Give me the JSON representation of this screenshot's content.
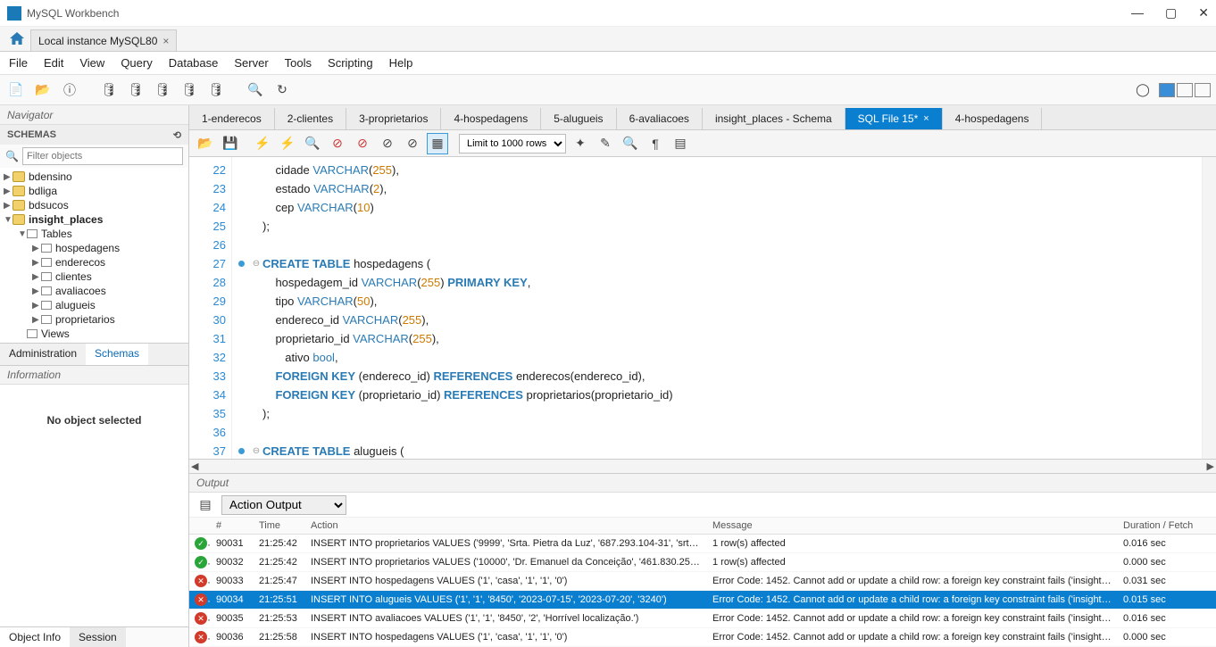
{
  "app_title": "MySQL Workbench",
  "connection_tab": "Local instance MySQL80",
  "menubar": [
    "File",
    "Edit",
    "View",
    "Query",
    "Database",
    "Server",
    "Tools",
    "Scripting",
    "Help"
  ],
  "navigator": {
    "title": "Navigator",
    "section": "SCHEMAS",
    "filter_placeholder": "Filter objects",
    "tree": {
      "schemas": [
        "bdensino",
        "bdliga",
        "bdsucos"
      ],
      "active_schema": "insight_places",
      "tables_label": "Tables",
      "tables": [
        "hospedagens",
        "enderecos",
        "clientes",
        "avaliacoes",
        "alugueis",
        "proprietarios"
      ],
      "views_label": "Views"
    },
    "nav_tabs": [
      "Administration",
      "Schemas"
    ],
    "info_title": "Information",
    "info_body": "No object selected",
    "bottom_tabs": [
      "Object Info",
      "Session"
    ]
  },
  "editor_tabs": [
    "1-enderecos",
    "2-clientes",
    "3-proprietarios",
    "4-hospedagens",
    "5-alugueis",
    "6-avaliacoes",
    "insight_places - Schema",
    "SQL File 15*",
    "4-hospedagens"
  ],
  "active_editor_tab_index": 7,
  "limit_label": "Limit to 1000 rows",
  "code_lines": [
    {
      "n": 22,
      "mark": false,
      "fold": "",
      "html": "    cidade <span class='ty'>VARCHAR</span>(<span class='num'>255</span>),"
    },
    {
      "n": 23,
      "mark": false,
      "fold": "",
      "html": "    estado <span class='ty'>VARCHAR</span>(<span class='num'>2</span>),"
    },
    {
      "n": 24,
      "mark": false,
      "fold": "",
      "html": "    cep <span class='ty'>VARCHAR</span>(<span class='num'>10</span>)"
    },
    {
      "n": 25,
      "mark": false,
      "fold": "",
      "html": ");"
    },
    {
      "n": 26,
      "mark": false,
      "fold": "",
      "html": ""
    },
    {
      "n": 27,
      "mark": true,
      "fold": "⊖",
      "html": "<span class='kw'>CREATE TABLE</span> hospedagens ("
    },
    {
      "n": 28,
      "mark": false,
      "fold": "",
      "html": "    hospedagem_id <span class='ty'>VARCHAR</span>(<span class='num'>255</span>) <span class='kw'>PRIMARY KEY</span>,"
    },
    {
      "n": 29,
      "mark": false,
      "fold": "",
      "html": "    tipo <span class='ty'>VARCHAR</span>(<span class='num'>50</span>),"
    },
    {
      "n": 30,
      "mark": false,
      "fold": "",
      "html": "    endereco_id <span class='ty'>VARCHAR</span>(<span class='num'>255</span>),"
    },
    {
      "n": 31,
      "mark": false,
      "fold": "",
      "html": "    proprietario_id <span class='ty'>VARCHAR</span>(<span class='num'>255</span>),"
    },
    {
      "n": 32,
      "mark": false,
      "fold": "",
      "html": "       ativo <span class='ty'>bool</span>,"
    },
    {
      "n": 33,
      "mark": false,
      "fold": "",
      "html": "    <span class='kw'>FOREIGN KEY</span> (endereco_id) <span class='kw'>REFERENCES</span> enderecos(endereco_id),"
    },
    {
      "n": 34,
      "mark": false,
      "fold": "",
      "html": "    <span class='kw'>FOREIGN KEY</span> (proprietario_id) <span class='kw'>REFERENCES</span> proprietarios(proprietario_id)"
    },
    {
      "n": 35,
      "mark": false,
      "fold": "",
      "html": ");"
    },
    {
      "n": 36,
      "mark": false,
      "fold": "",
      "html": ""
    },
    {
      "n": 37,
      "mark": true,
      "fold": "⊖",
      "html": "<span class='kw'>CREATE TABLE</span> alugueis ("
    }
  ],
  "output": {
    "title": "Output",
    "dropdown": "Action Output",
    "headers": [
      "",
      "#",
      "Time",
      "Action",
      "Message",
      "Duration / Fetch"
    ],
    "rows": [
      {
        "status": "ok",
        "n": "90031",
        "t": "21:25:42",
        "action": "INSERT INTO proprietarios VALUES ('9999', 'Srta. Pietra da Luz', '687.293.104-31', 'srta._3...",
        "msg": "1 row(s) affected",
        "dur": "0.016 sec",
        "sel": false
      },
      {
        "status": "ok",
        "n": "90032",
        "t": "21:25:42",
        "action": "INSERT INTO proprietarios VALUES ('10000', 'Dr. Emanuel da Conceição', '461.830.257-71...",
        "msg": "1 row(s) affected",
        "dur": "0.000 sec",
        "sel": false
      },
      {
        "status": "err",
        "n": "90033",
        "t": "21:25:47",
        "action": "INSERT INTO hospedagens VALUES ('1', 'casa', '1', '1', '0')",
        "msg": "Error Code: 1452. Cannot add or update a child row: a foreign key constraint fails ('insight_pl...",
        "dur": "0.031 sec",
        "sel": false
      },
      {
        "status": "err",
        "n": "90034",
        "t": "21:25:51",
        "action": "INSERT INTO alugueis VALUES ('1', '1', '8450', '2023-07-15', '2023-07-20', '3240')",
        "msg": "Error Code: 1452. Cannot add or update a child row: a foreign key constraint fails ('insight_pl...",
        "dur": "0.015 sec",
        "sel": true
      },
      {
        "status": "err",
        "n": "90035",
        "t": "21:25:53",
        "action": "INSERT INTO avaliacoes VALUES ('1', '1', '8450', '2', 'Horrível localização.')",
        "msg": "Error Code: 1452. Cannot add or update a child row: a foreign key constraint fails ('insight_pl...",
        "dur": "0.016 sec",
        "sel": false
      },
      {
        "status": "err",
        "n": "90036",
        "t": "21:25:58",
        "action": "INSERT INTO hospedagens VALUES ('1', 'casa', '1', '1', '0')",
        "msg": "Error Code: 1452. Cannot add or update a child row: a foreign key constraint fails ('insight_pl...",
        "dur": "0.000 sec",
        "sel": false
      }
    ]
  }
}
